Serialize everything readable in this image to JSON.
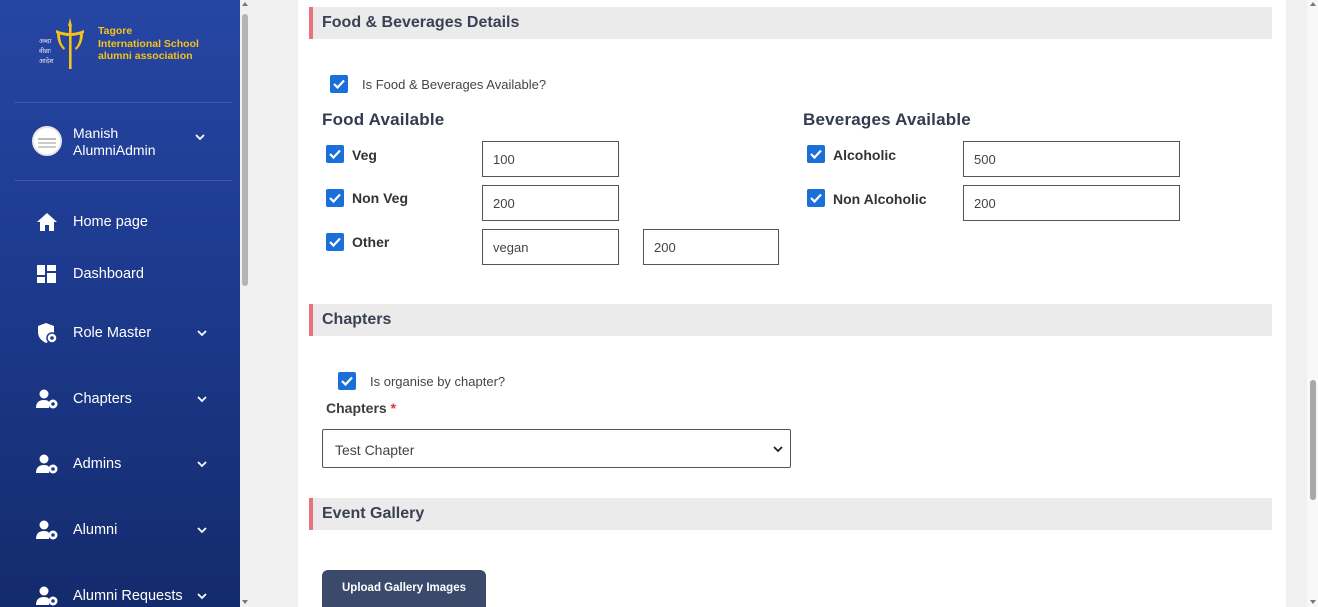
{
  "brand": {
    "line1": "Tagore",
    "line2": "International School",
    "line3": "alumni association",
    "accent": "#f5c21a"
  },
  "user": {
    "first_name": "Manish",
    "role_name": "AlumniAdmin"
  },
  "nav": [
    {
      "label": "Home page",
      "icon": "home-icon",
      "expandable": false
    },
    {
      "label": "Dashboard",
      "icon": "dashboard-icon",
      "expandable": false
    },
    {
      "label": "Role Master",
      "icon": "role-shield-icon",
      "expandable": true
    },
    {
      "label": "Chapters",
      "icon": "user-gear-icon",
      "expandable": true
    },
    {
      "label": "Admins",
      "icon": "user-gear-icon",
      "expandable": true
    },
    {
      "label": "Alumni",
      "icon": "user-gear-icon",
      "expandable": true
    },
    {
      "label": "Alumni Requests",
      "icon": "user-gear-icon",
      "expandable": true
    }
  ],
  "food_section": {
    "title": "Food & Beverages Details",
    "available_label": "Is Food & Beverages Available?",
    "available_checked": true,
    "food_title": "Food Available",
    "food_items": [
      {
        "label": "Veg",
        "checked": true,
        "value": "100"
      },
      {
        "label": "Non Veg",
        "checked": true,
        "value": "200"
      },
      {
        "label": "Other",
        "checked": true,
        "name_value": "vegan",
        "value": "200"
      }
    ],
    "beverages_title": "Beverages Available",
    "beverage_items": [
      {
        "label": "Alcoholic",
        "checked": true,
        "value": "500"
      },
      {
        "label": "Non Alcoholic",
        "checked": true,
        "value": "200"
      }
    ]
  },
  "chapters_section": {
    "title": "Chapters",
    "organise_label": "Is organise by chapter?",
    "organise_checked": true,
    "field_label": "Chapters",
    "required_mark": "*",
    "selected": "Test Chapter"
  },
  "gallery_section": {
    "title": "Event Gallery",
    "upload_label": "Upload Gallery Images"
  },
  "colors": {
    "sidebar": "#1d3a8e",
    "section_accent": "#e8737a",
    "checkbox": "#1a6fd8",
    "button": "#3b4a6b"
  }
}
